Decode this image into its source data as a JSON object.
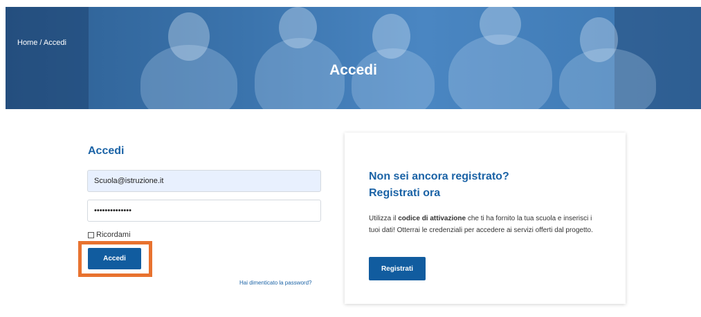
{
  "breadcrumb": {
    "home": "Home",
    "separator": " / ",
    "current": "Accedi"
  },
  "banner": {
    "title": "Accedi"
  },
  "login": {
    "title": "Accedi",
    "email_value": "Scuola@istruzione.it",
    "password_value": "••••••••••••••",
    "remember_label": "Ricordami",
    "submit_label": "Accedi",
    "forgot_link": "Hai dimenticato la password?"
  },
  "register": {
    "title_line1": "Non sei ancora registrato?",
    "title_line2": "Registrati ora",
    "text_before": "Utilizza il ",
    "text_bold": "codice di attivazione",
    "text_after": " che ti ha fornito la tua scuola e inserisci i tuoi dati! Otterrai le credenziali per accedere ai servizi offerti dal progetto.",
    "button_label": "Registrati"
  },
  "colors": {
    "accent": "#1b63a6",
    "button": "#115c9f",
    "highlight": "#e8722f",
    "banner": "#3b74ad"
  }
}
